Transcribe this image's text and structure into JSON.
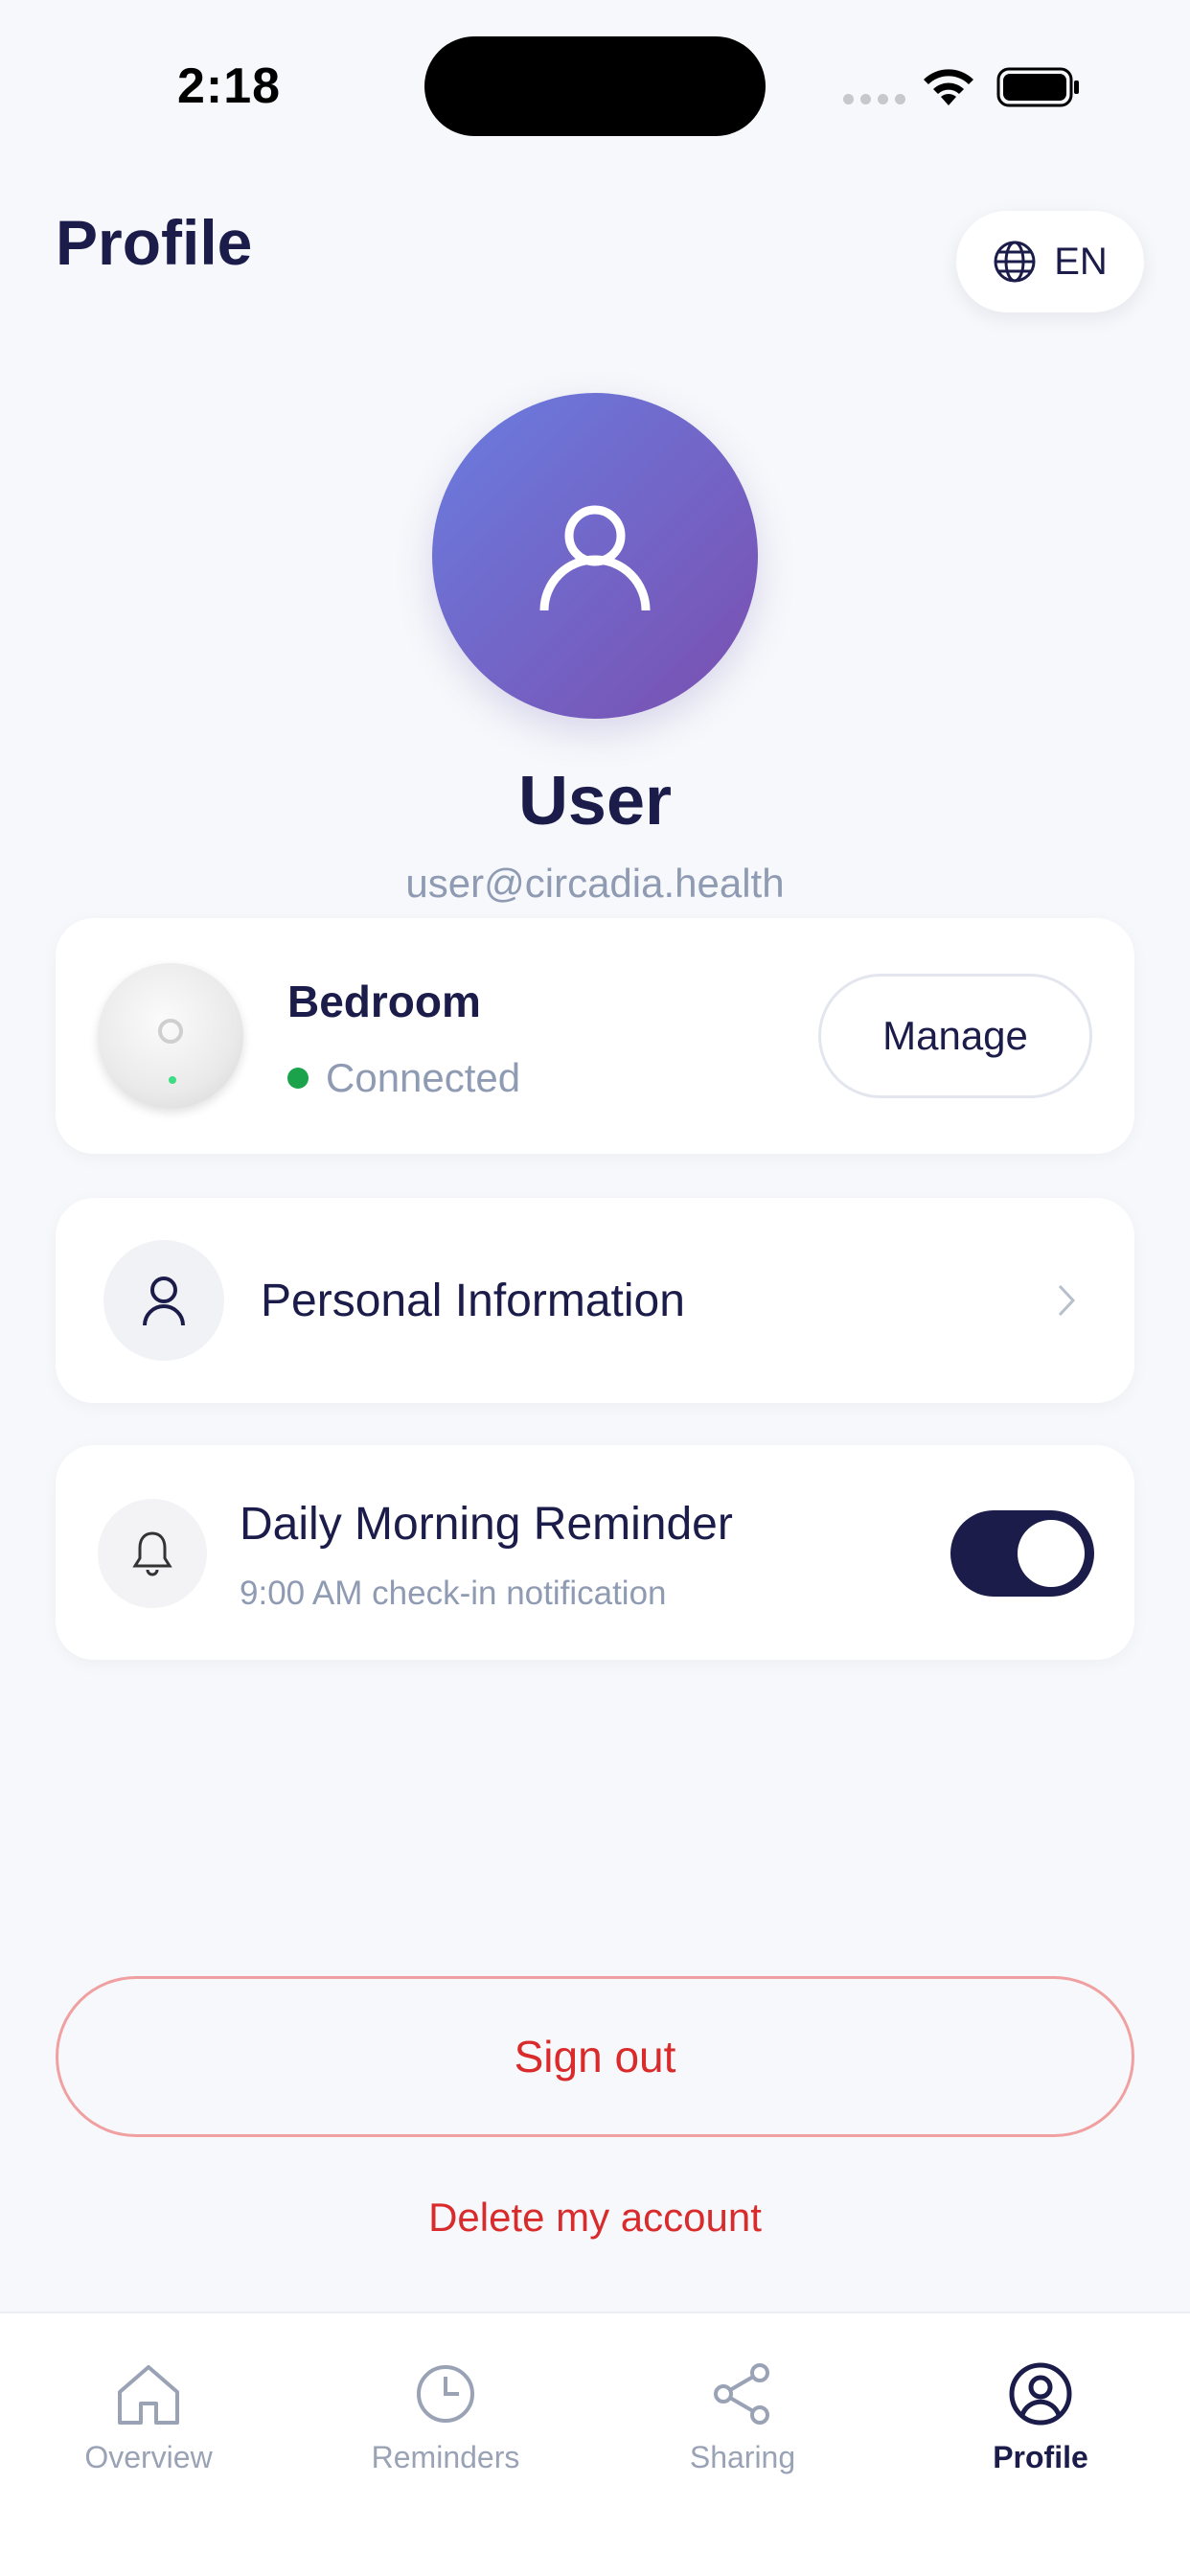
{
  "status_bar": {
    "time": "2:18"
  },
  "header": {
    "title": "Profile",
    "language_label": "EN",
    "language_icon": "globe-icon"
  },
  "profile": {
    "name": "User",
    "email": "user@circadia.health",
    "avatar_icon": "user-icon"
  },
  "device": {
    "name": "Bedroom",
    "status": "Connected",
    "status_color": "#1aa34a",
    "manage_label": "Manage"
  },
  "personal_info": {
    "label": "Personal Information",
    "icon": "person-icon"
  },
  "reminder": {
    "title": "Daily Morning Reminder",
    "subtitle": "9:00 AM check-in notification",
    "enabled": true,
    "icon": "bell-icon"
  },
  "actions": {
    "sign_out": "Sign out",
    "delete_account": "Delete my account"
  },
  "tabs": [
    {
      "label": "Overview",
      "icon": "home-icon",
      "active": false
    },
    {
      "label": "Reminders",
      "icon": "clock-icon",
      "active": false
    },
    {
      "label": "Sharing",
      "icon": "share-icon",
      "active": false
    },
    {
      "label": "Profile",
      "icon": "profile-icon",
      "active": true
    }
  ],
  "colors": {
    "primary": "#1c1c4a",
    "muted": "#8f9bb3",
    "danger": "#d92b2b",
    "avatar_gradient_start": "#6a7de0",
    "avatar_gradient_end": "#7a4fb0"
  }
}
